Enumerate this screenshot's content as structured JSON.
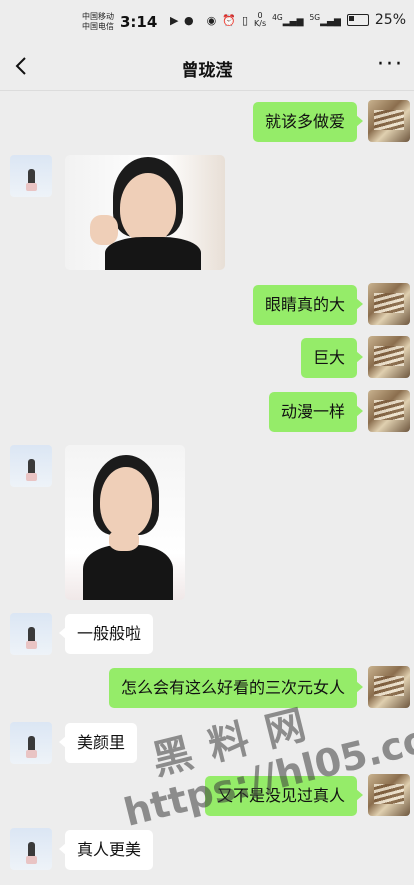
{
  "status_bar": {
    "carrier1": "中国移动",
    "carrier2": "中国电信",
    "time": "3:14",
    "net_speed_value": "0",
    "net_speed_unit": "K/s",
    "sim1_label": "4G",
    "sim2_label": "5G",
    "battery": "25%"
  },
  "header": {
    "title": "曾珑滢",
    "more_label": "···"
  },
  "messages": [
    {
      "side": "me",
      "text": "就该多做爱"
    },
    {
      "side": "them",
      "type": "image"
    },
    {
      "side": "me",
      "text": "眼睛真的大"
    },
    {
      "side": "me",
      "text": "巨大"
    },
    {
      "side": "me",
      "text": "动漫一样"
    },
    {
      "side": "them",
      "type": "image"
    },
    {
      "side": "them",
      "text": "一般般啦"
    },
    {
      "side": "me",
      "text": "怎么会有这么好看的三次元女人"
    },
    {
      "side": "them",
      "text": "美颜里"
    },
    {
      "side": "me",
      "text": "又不是没见过真人"
    },
    {
      "side": "them",
      "text": "真人更美"
    }
  ],
  "watermark": {
    "line1": "黑料网",
    "line2": "https://hl05.co"
  },
  "colors": {
    "bubble_me": "#95ec69",
    "bubble_them": "#ffffff",
    "background": "#ededed"
  }
}
